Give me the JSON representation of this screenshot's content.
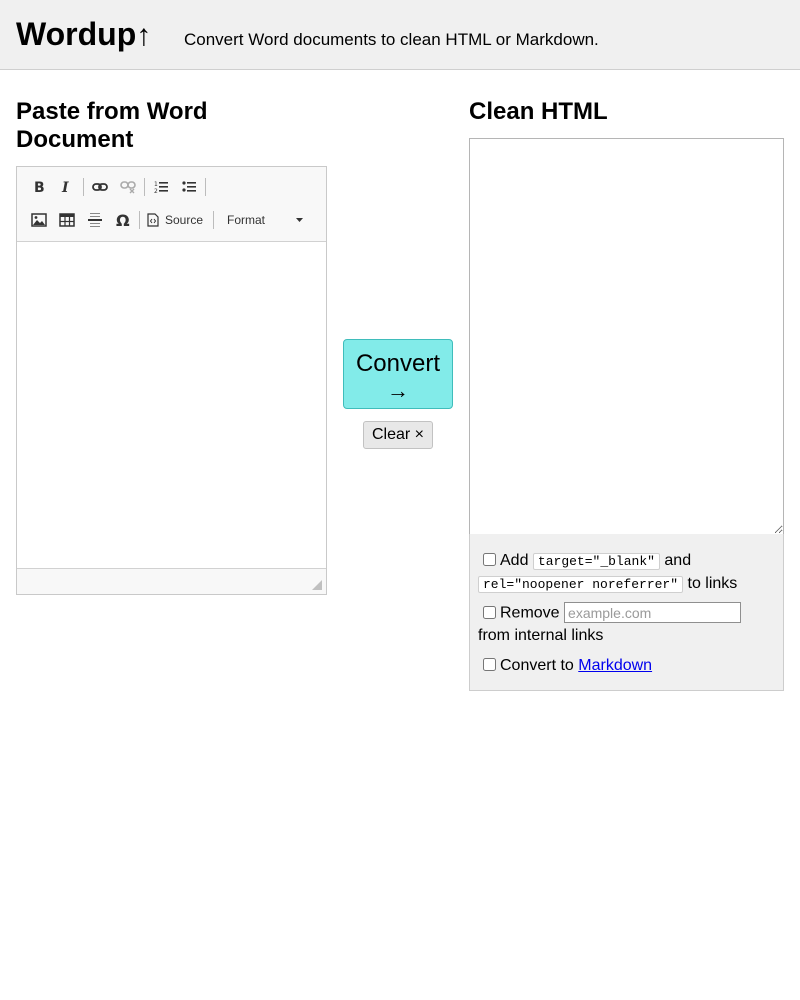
{
  "header": {
    "brand": "Wordup",
    "brand_arrow": "↑",
    "tagline": "Convert Word documents to clean HTML or Markdown."
  },
  "left": {
    "title": "Paste from Word Document",
    "toolbar": {
      "row1": [
        "bold-icon",
        "italic-icon",
        "link-icon",
        "unlink-icon",
        "numbered-list-icon",
        "bulleted-list-icon"
      ],
      "row2": [
        "image-icon",
        "table-icon",
        "horizontal-line-icon",
        "special-character-icon",
        "source-icon",
        "format-dropdown"
      ],
      "source_label": "Source",
      "format_label": "Format"
    }
  },
  "actions": {
    "convert_label": "Convert",
    "convert_arrow": "→",
    "clear_label": "Clear ×"
  },
  "right": {
    "title": "Clean HTML",
    "output_value": "",
    "options": {
      "add_prefix": "Add",
      "target_code": "target=\"_blank\"",
      "and_text": "and",
      "rel_code": "rel=\"noopener noreferrer\"",
      "to_links": "to links",
      "remove_label": "Remove",
      "domain_placeholder": "example.com",
      "from_internal": "from internal links",
      "markdown_prefix": "Convert to",
      "markdown_link": "Markdown"
    }
  },
  "colors": {
    "header_bg": "#f0f0f0",
    "convert_bg": "#82ebe9",
    "link": "#0000ee"
  }
}
